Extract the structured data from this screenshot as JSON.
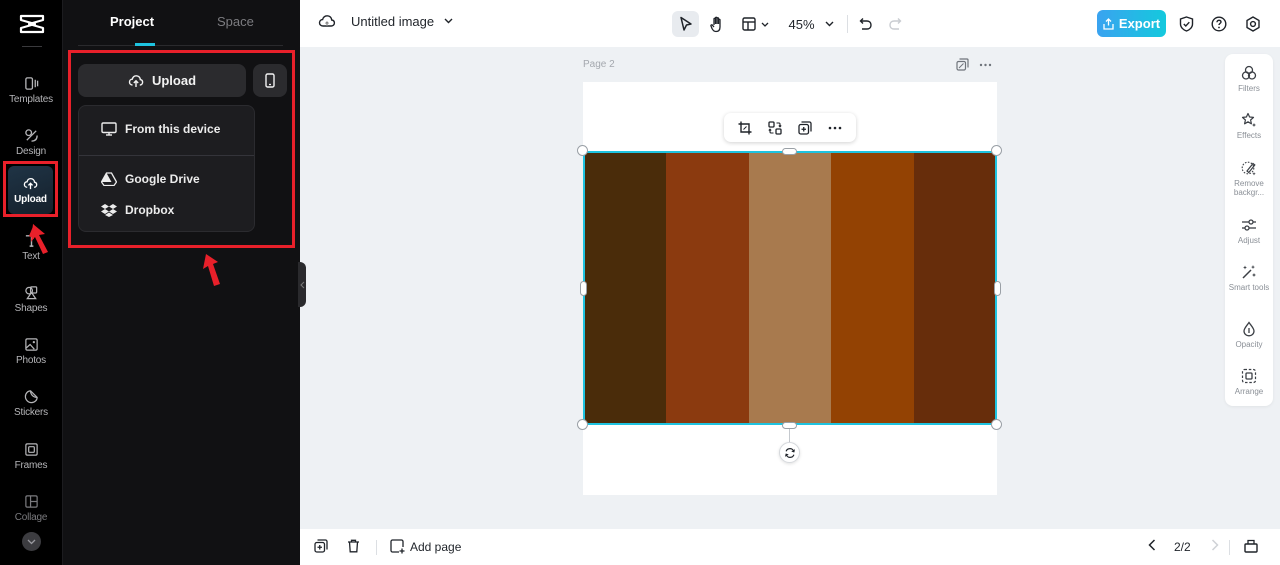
{
  "rail": {
    "items": [
      {
        "label": "Templates",
        "icon": "templates-icon"
      },
      {
        "label": "Design",
        "icon": "design-icon"
      },
      {
        "label": "Upload",
        "icon": "upload-cloud-icon",
        "active": true
      },
      {
        "label": "Text",
        "icon": "text-icon"
      },
      {
        "label": "Shapes",
        "icon": "shapes-icon"
      },
      {
        "label": "Photos",
        "icon": "photos-icon"
      },
      {
        "label": "Stickers",
        "icon": "stickers-icon"
      },
      {
        "label": "Frames",
        "icon": "frames-icon"
      },
      {
        "label": "Collage",
        "icon": "collage-icon"
      }
    ],
    "more_icon": "chevron-down-icon"
  },
  "panel": {
    "tabs": [
      {
        "label": "Project",
        "active": true
      },
      {
        "label": "Space",
        "active": false
      }
    ],
    "upload_button": "Upload",
    "phone_icon": "mobile-phone-icon",
    "dropdown": [
      {
        "label": "From this device",
        "icon": "monitor-icon"
      },
      {
        "label": "Google Drive",
        "icon": "google-drive-icon"
      },
      {
        "label": "Dropbox",
        "icon": "dropbox-icon"
      }
    ]
  },
  "topbar": {
    "doc_title": "Untitled image",
    "zoom_level": "45%",
    "export_label": "Export",
    "accent": "#1ec3e0"
  },
  "canvas": {
    "page_label": "Page 2",
    "stripe_colors": [
      "#4a2c0a",
      "#8b3a0f",
      "#a87a4e",
      "#934203",
      "#672d0b"
    ],
    "selection_color": "#1ec3e0"
  },
  "right_tools": [
    {
      "label": "Filters"
    },
    {
      "label": "Effects"
    },
    {
      "label": "Remove backgr..."
    },
    {
      "label": "Adjust"
    },
    {
      "label": "Smart tools"
    },
    {
      "label": "Opacity"
    },
    {
      "label": "Arrange"
    }
  ],
  "bottombar": {
    "add_page_label": "Add page",
    "page_indicator": "2/2"
  },
  "annotations": {
    "highlight_color": "#e8202a"
  }
}
